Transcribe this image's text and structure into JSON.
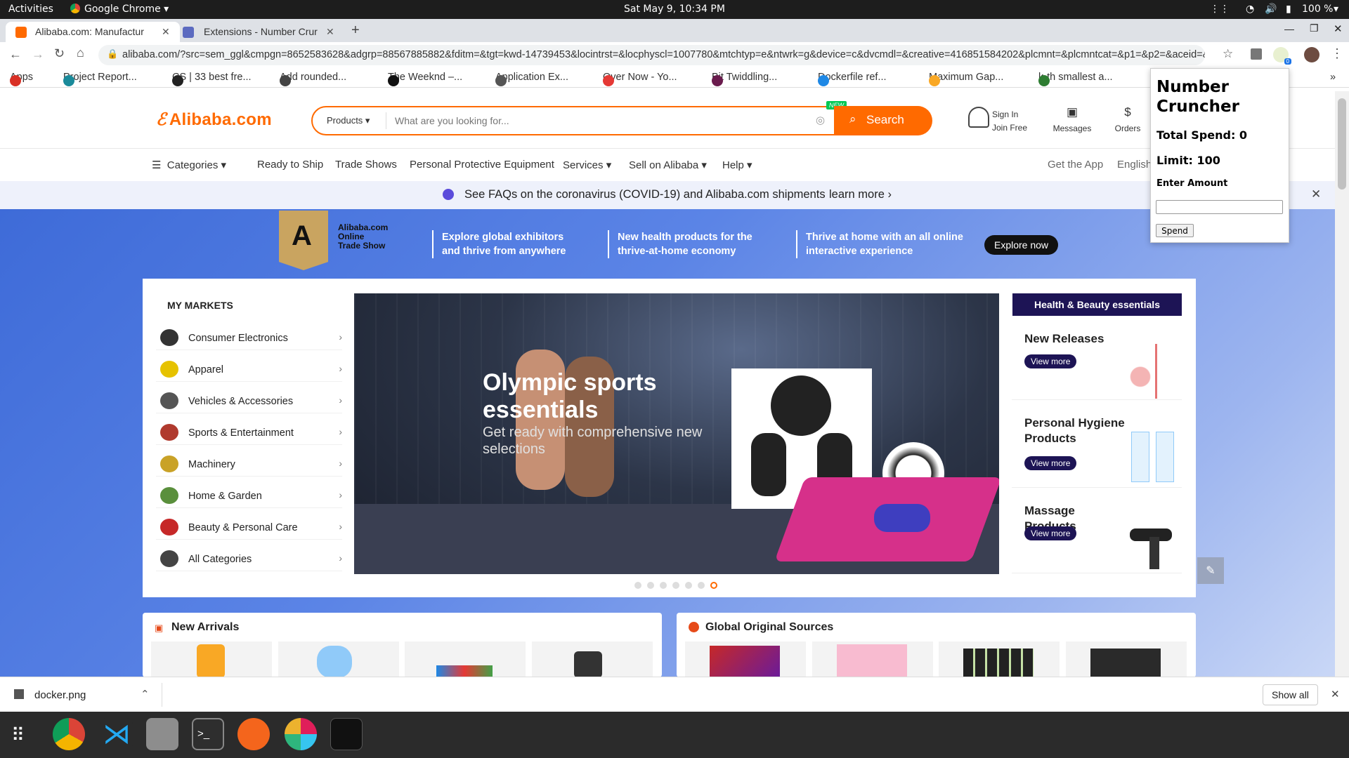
{
  "system_bar": {
    "activities": "Activities",
    "app": "Google Chrome",
    "clock": "Sat May  9, 10:34 PM",
    "battery": "100 %"
  },
  "tabs": [
    {
      "label": "Alibaba.com: Manufactur"
    },
    {
      "label": "Extensions - Number Crur"
    }
  ],
  "address": {
    "url": "alibaba.com/?src=sem_ggl&cmpgn=8652583628&adgrp=88567885882&fditm=&tgt=kwd-14739453&locintrst=&locphyscl=1007780&mtchtyp=e&ntwrk=g&device=c&dvcmdl=&creative=416851584202&plcmnt=&plcmntcat=&p1=&p2=&aceid=&..."
  },
  "bookmarks": [
    {
      "label": "Apps",
      "color": "#d93025"
    },
    {
      "label": "Project Report...",
      "color": "#1a8a9a"
    },
    {
      "label": "CS | 33 best fre...",
      "color": "#222222"
    },
    {
      "label": "Add rounded...",
      "color": "#444444"
    },
    {
      "label": "The Weeknd –...",
      "color": "#111111"
    },
    {
      "label": "Application Ex...",
      "color": "#555555"
    },
    {
      "label": "Over Now - Yo...",
      "color": "#e53935"
    },
    {
      "label": "Bit Twiddling...",
      "color": "#6a1b4d"
    },
    {
      "label": "Dockerfile ref...",
      "color": "#1e88e5"
    },
    {
      "label": "Maximum Gap...",
      "color": "#f9a825"
    },
    {
      "label": "k-th smallest a...",
      "color": "#2e7d32"
    }
  ],
  "header": {
    "logo": "Alibaba.com",
    "search_category": "Products",
    "search_placeholder": "What are you looking for...",
    "new_badge": "NEW",
    "search_button": "Search",
    "sign_in": "Sign In",
    "join": "Join Free",
    "messages": "Messages",
    "orders": "Orders"
  },
  "nav": {
    "categories": "Categories",
    "ready": "Ready to Ship",
    "trade": "Trade Shows",
    "ppe": "Personal Protective Equipment",
    "services": "Services",
    "sell": "Sell on Alibaba",
    "help": "Help",
    "get_app": "Get the App",
    "lang": "English"
  },
  "notice": {
    "text": "See FAQs on the coronavirus (COVID-19) and Alibaba.com shipments",
    "link": "learn more"
  },
  "trade_show": {
    "logo_l1": "Alibaba.com",
    "logo_l2": "Online",
    "logo_l3": "Trade Show",
    "msg1": "Explore global exhibitors and thrive from anywhere",
    "msg2": "New health products for the thrive-at-home economy",
    "msg3": "Thrive at home with an  all online interactive experience",
    "cta": "Explore now"
  },
  "markets": {
    "title": "MY MARKETS",
    "items": [
      {
        "label": "Consumer Electronics",
        "color": "#333333"
      },
      {
        "label": "Apparel",
        "color": "#e6c200"
      },
      {
        "label": "Vehicles & Accessories",
        "color": "#555555"
      },
      {
        "label": "Sports & Entertainment",
        "color": "#b03a2e"
      },
      {
        "label": "Machinery",
        "color": "#c9a227"
      },
      {
        "label": "Home & Garden",
        "color": "#5a8f3c"
      },
      {
        "label": "Beauty & Personal Care",
        "color": "#c62828"
      },
      {
        "label": "All Categories",
        "color": "#444444"
      }
    ]
  },
  "carousel": {
    "title": "Olympic sports essentials",
    "subtitle": "Get ready with comprehensive new selections",
    "dots": 7,
    "active_dot": 7
  },
  "right_panel": {
    "header": "Health & Beauty essentials",
    "view_more": "View more",
    "cards": [
      {
        "title": "New Releases"
      },
      {
        "title": "Personal Hygiene Products"
      },
      {
        "title": "Massage Products"
      }
    ]
  },
  "sections": {
    "new_arrivals": "New Arrivals",
    "global": "Global Original Sources"
  },
  "extension": {
    "title": "Number Cruncher",
    "total": "Total Spend: 0",
    "limit": "Limit: 100",
    "enter": "Enter Amount",
    "button": "Spend",
    "badge": "0"
  },
  "download": {
    "file": "docker.png",
    "show_all": "Show all"
  }
}
